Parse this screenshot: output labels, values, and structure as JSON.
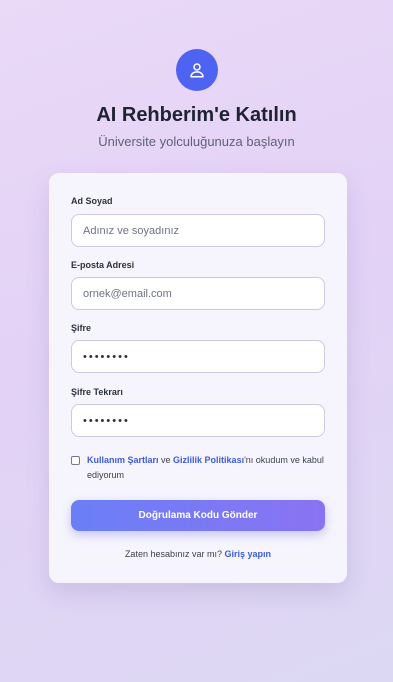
{
  "header": {
    "title": "AI Rehberim'e Katılın",
    "subtitle": "Üniversite yolculuğunuza başlayın",
    "icon": "user-icon",
    "accent": "#4f63f2"
  },
  "form": {
    "name": {
      "label": "Ad Soyad",
      "placeholder": "Adınız ve soyadınız",
      "value": ""
    },
    "email": {
      "label": "E-posta Adresi",
      "placeholder": "ornek@email.com",
      "value": ""
    },
    "password": {
      "label": "Şifre",
      "value": "••••••••"
    },
    "password_confirm": {
      "label": "Şifre Tekrarı",
      "value": "••••••••"
    },
    "terms": {
      "checked": false,
      "link1": "Kullanım Şartları",
      "connector": " ve ",
      "link2": "Gizlilik Politikası",
      "suffix": "'nı okudum ve kabul ediyorum"
    },
    "submit_label": "Doğrulama Kodu Gönder",
    "login_prompt": "Zaten hesabınız var mı?",
    "login_link": "Giriş yapın"
  }
}
